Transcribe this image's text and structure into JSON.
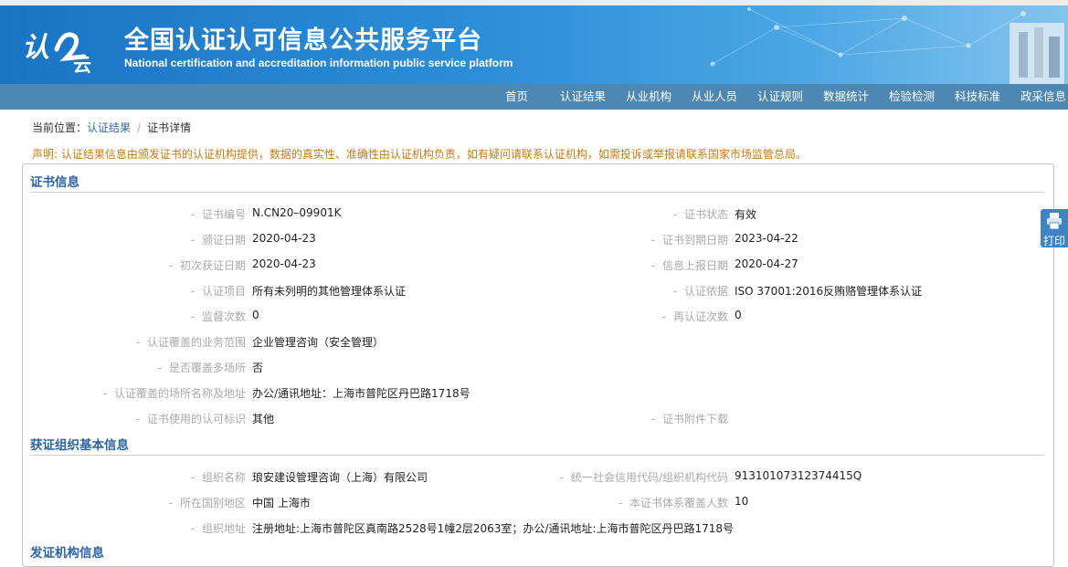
{
  "header": {
    "logo_text": "认云",
    "title_cn": "全国认证认可信息公共服务平台",
    "title_en": "National certification and accreditation information public service platform"
  },
  "nav": {
    "items": [
      "首页",
      "认证结果",
      "从业机构",
      "从业人员",
      "认证规则",
      "数据统计",
      "检验检测",
      "科技标准",
      "政采信息"
    ]
  },
  "breadcrumb": {
    "prefix": "当前位置：",
    "link": "认证结果",
    "separator": "/",
    "current": "证书详情"
  },
  "notice": "声明: 认证结果信息由颁发证书的认证机构提供，数据的真实性、准确性由认证机构负责，如有疑问请联系认证机构，如需投诉或举报请联系国家市场监管总局。",
  "print_button": {
    "label": "打印",
    "icon": "printer-icon"
  },
  "cert_section": {
    "title": "证书信息",
    "fields": [
      {
        "label": "证书编号",
        "value": "N.CN20–09901K"
      },
      {
        "label": "证书状态",
        "value": "有效"
      },
      {
        "label": "颁证日期",
        "value": "2020-04-23"
      },
      {
        "label": "证书到期日期",
        "value": "2023-04-22"
      },
      {
        "label": "初次获证日期",
        "value": "2020-04-23"
      },
      {
        "label": "信息上报日期",
        "value": "2020-04-27"
      },
      {
        "label": "认证项目",
        "value": "所有未列明的其他管理体系认证"
      },
      {
        "label": "认证依据",
        "value": "ISO 37001:2016反贿赂管理体系认证"
      },
      {
        "label": "监督次数",
        "value": "0"
      },
      {
        "label": "再认证次数",
        "value": "0"
      },
      {
        "label": "认证覆盖的业务范围",
        "value": "企业管理咨询（安全管理）"
      },
      {
        "label": "是否覆盖多场所",
        "value": "否"
      },
      {
        "label": "认证覆盖的场所名称及地址",
        "value": "办公/通讯地址：上海市普陀区丹巴路1718号"
      },
      {
        "label": "证书使用的认可标识",
        "value": "其他"
      },
      {
        "label": "证书附件下载",
        "value": ""
      }
    ]
  },
  "org_section": {
    "title": "获证组织基本信息",
    "fields": [
      {
        "label": "组织名称",
        "value": "琅安建设管理咨询（上海）有限公司"
      },
      {
        "label": "统一社会信用代码/组织机构代码",
        "value": "91310107312374415Q"
      },
      {
        "label": "所在国别地区",
        "value": "中国 上海市"
      },
      {
        "label": "本证书体系覆盖人数",
        "value": "10"
      },
      {
        "label": "组织地址",
        "value": "注册地址:上海市普陀区真南路2528号1幢2层2063室；办公/通讯地址:上海市普陀区丹巴路1718号"
      }
    ]
  },
  "next_section": {
    "title": "发证机构信息"
  },
  "colors": {
    "header_blue": "#1a74c4",
    "nav_bar": "#4d88b4",
    "section_title": "#2c64a4",
    "notice": "#c8790b",
    "label_gray": "#aaaaaa"
  }
}
